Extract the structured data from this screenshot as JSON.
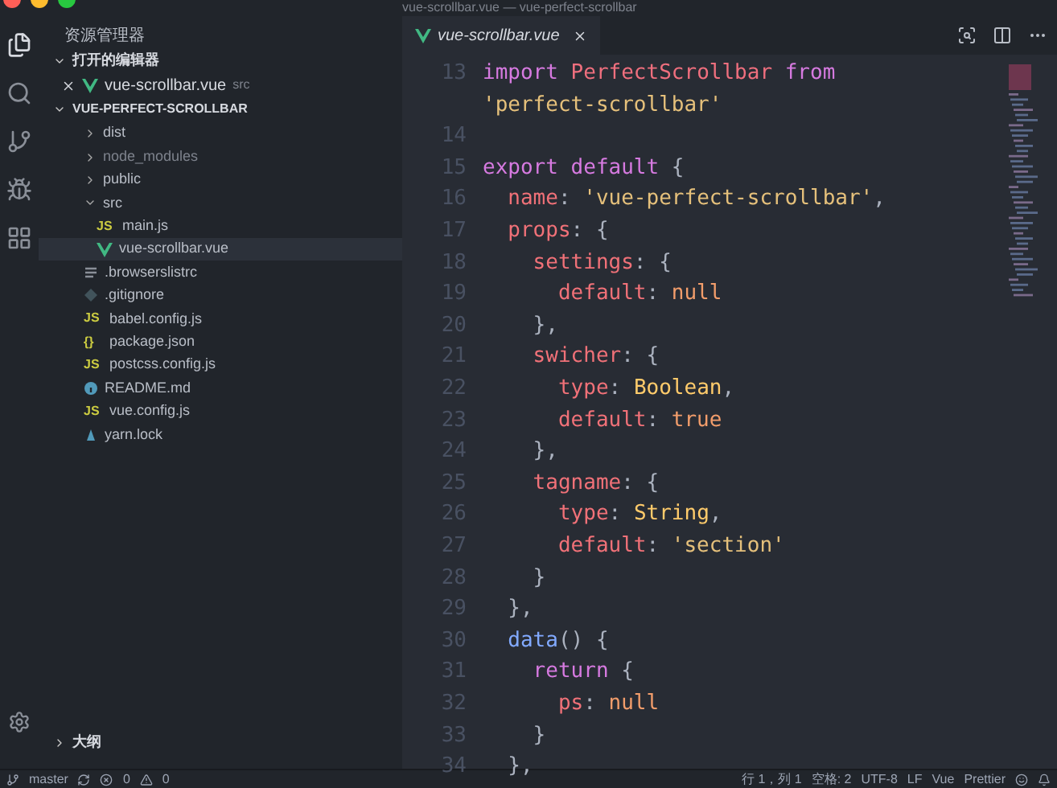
{
  "window": {
    "title": "vue-scrollbar.vue — vue-perfect-scrollbar"
  },
  "sidebar": {
    "title": "资源管理器",
    "open_editors": {
      "title": "打开的编辑器",
      "expanded": true,
      "items": [
        {
          "label": "vue-scrollbar.vue",
          "path": "src",
          "kind": "vue"
        }
      ]
    },
    "project": {
      "title": "VUE-PERFECT-SCROLLBAR",
      "expanded": true,
      "items": [
        {
          "label": "dist",
          "kind": "folder",
          "expanded": false,
          "selected": false
        },
        {
          "label": "node_modules",
          "kind": "folder",
          "expanded": false,
          "selected": false,
          "dimmed": true
        },
        {
          "label": "public",
          "kind": "folder",
          "expanded": false,
          "selected": false
        },
        {
          "label": "src",
          "kind": "folder",
          "expanded": true,
          "selected": false,
          "children": [
            {
              "label": "main.js",
              "kind": "js",
              "icon": "JS",
              "selected": false
            },
            {
              "label": "vue-scrollbar.vue",
              "kind": "vue",
              "selected": true
            }
          ]
        },
        {
          "label": ".browserslistrc",
          "kind": "text",
          "selected": false
        },
        {
          "label": ".gitignore",
          "kind": "git",
          "selected": false
        },
        {
          "label": "babel.config.js",
          "kind": "js",
          "icon": "JS",
          "selected": false
        },
        {
          "label": "package.json",
          "kind": "json",
          "icon": "{}",
          "selected": false
        },
        {
          "label": "postcss.config.js",
          "kind": "js",
          "icon": "JS",
          "selected": false
        },
        {
          "label": "README.md",
          "kind": "info",
          "selected": false
        },
        {
          "label": "vue.config.js",
          "kind": "js",
          "icon": "JS",
          "selected": false
        },
        {
          "label": "yarn.lock",
          "kind": "yarn",
          "selected": false
        }
      ]
    },
    "outline": {
      "title": "大纲",
      "expanded": false
    }
  },
  "tabs": [
    {
      "label": "vue-scrollbar.vue",
      "selected": true
    }
  ],
  "editor": {
    "lines": [
      {
        "number": "13",
        "tokens": [
          {
            "t": "import ",
            "kind": "keyword"
          },
          {
            "t": "PerfectScrollbar ",
            "kind": "class"
          },
          {
            "t": "from",
            "kind": "keyword"
          }
        ]
      },
      {
        "tokens": [
          {
            "t": "'perfect-scrollbar'",
            "kind": "string"
          }
        ]
      },
      {
        "number": "14"
      },
      {
        "number": "15",
        "tokens": [
          {
            "t": "export default ",
            "kind": "keyword"
          },
          {
            "t": "{"
          }
        ]
      },
      {
        "number": "16",
        "tokens": [
          {
            "t": "  name",
            "kind": "prop"
          },
          {
            "t": ": "
          },
          {
            "t": "'vue-perfect-scrollbar'",
            "kind": "string"
          },
          {
            "t": ","
          }
        ]
      },
      {
        "number": "17",
        "tokens": [
          {
            "t": "  props",
            "kind": "prop"
          },
          {
            "t": ": {"
          }
        ]
      },
      {
        "number": "18",
        "tokens": [
          {
            "t": "    settings",
            "kind": "prop"
          },
          {
            "t": ": {"
          }
        ]
      },
      {
        "number": "19",
        "tokens": [
          {
            "t": "      default",
            "kind": "prop"
          },
          {
            "t": ": "
          },
          {
            "t": "null",
            "kind": "literal"
          }
        ]
      },
      {
        "number": "20",
        "tokens": [
          {
            "t": "    },"
          }
        ]
      },
      {
        "number": "21",
        "tokens": [
          {
            "t": "    swicher",
            "kind": "prop"
          },
          {
            "t": ": {"
          }
        ]
      },
      {
        "number": "22",
        "tokens": [
          {
            "t": "      type",
            "kind": "prop"
          },
          {
            "t": ": "
          },
          {
            "t": "Boolean",
            "kind": "type"
          },
          {
            "t": ","
          }
        ]
      },
      {
        "number": "23",
        "tokens": [
          {
            "t": "      default",
            "kind": "prop"
          },
          {
            "t": ": "
          },
          {
            "t": "true",
            "kind": "literal"
          }
        ]
      },
      {
        "number": "24",
        "tokens": [
          {
            "t": "    },"
          }
        ]
      },
      {
        "number": "25",
        "tokens": [
          {
            "t": "    tagname",
            "kind": "prop"
          },
          {
            "t": ": {"
          }
        ]
      },
      {
        "number": "26",
        "tokens": [
          {
            "t": "      type",
            "kind": "prop"
          },
          {
            "t": ": "
          },
          {
            "t": "String",
            "kind": "type"
          },
          {
            "t": ","
          }
        ]
      },
      {
        "number": "27",
        "tokens": [
          {
            "t": "      default",
            "kind": "prop"
          },
          {
            "t": ": "
          },
          {
            "t": "'section'",
            "kind": "string"
          }
        ]
      },
      {
        "number": "28",
        "tokens": [
          {
            "t": "    }"
          }
        ]
      },
      {
        "number": "29",
        "tokens": [
          {
            "t": "  },"
          }
        ]
      },
      {
        "number": "30",
        "tokens": [
          {
            "t": "  data",
            "kind": "func"
          },
          {
            "t": "() {"
          }
        ]
      },
      {
        "number": "31",
        "tokens": [
          {
            "t": "    return ",
            "kind": "keyword"
          },
          {
            "t": "{"
          }
        ]
      },
      {
        "number": "32",
        "tokens": [
          {
            "t": "      ps",
            "kind": "prop"
          },
          {
            "t": ": "
          },
          {
            "t": "null",
            "kind": "literal"
          }
        ]
      },
      {
        "number": "33",
        "tokens": [
          {
            "t": "    }"
          }
        ]
      },
      {
        "number": "34",
        "tokens": [
          {
            "t": "  },"
          }
        ]
      }
    ]
  },
  "status_bar": {
    "branch": "master",
    "errors": "0",
    "warnings": "0",
    "items": [
      "行 1，列 1",
      "空格: 2",
      "UTF-8",
      "LF",
      "Vue",
      "Prettier"
    ]
  }
}
